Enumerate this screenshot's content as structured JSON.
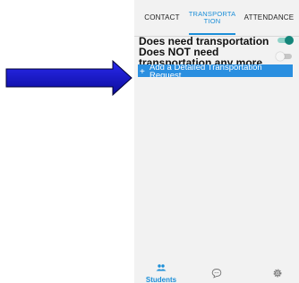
{
  "tabs": {
    "contact": "CONTACT",
    "transportation": "TRANSPORTA\nTION",
    "attendance": "ATTENDANCE"
  },
  "options": [
    {
      "label": "Does need transportation",
      "enabled": true
    },
    {
      "label": "Does NOT need transportation any more",
      "enabled": false
    }
  ],
  "add_button": {
    "plus": "+",
    "label": "Add a Detailed Transportation Request"
  },
  "bottom_nav": {
    "students_label": "Students",
    "chat_icon": "chat-bubble-icon",
    "settings_icon": "gear-icon",
    "students_icon": "people-icon"
  },
  "colors": {
    "accent": "#1c8fd8",
    "toggle_on": "#14857a",
    "button": "#2a8fe0",
    "arrow": "#1414c8"
  }
}
